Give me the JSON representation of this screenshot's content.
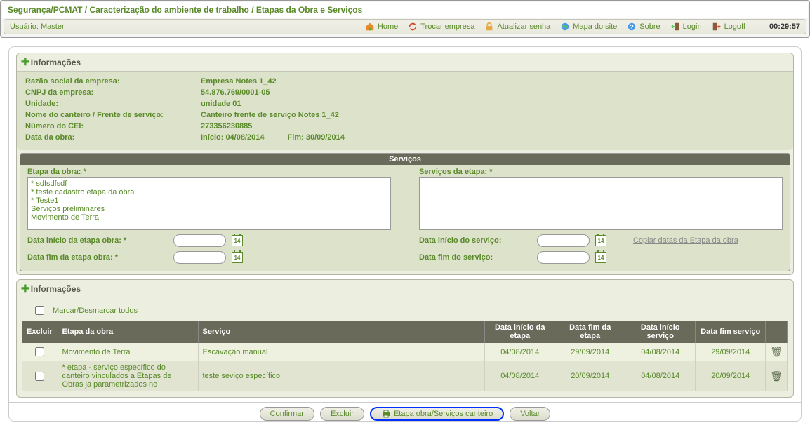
{
  "breadcrumb": "Segurança/PCMAT / Caracterização do ambiente de trabalho / Etapas da Obra e Serviços",
  "user": {
    "label": "Usuário: Master"
  },
  "nav": {
    "home": "Home",
    "trocar_empresa": "Trocar empresa",
    "atualizar_senha": "Atualizar senha",
    "mapa_site": "Mapa do site",
    "sobre": "Sobre",
    "login": "Login",
    "logoff": "Logoff"
  },
  "timer": "00:29:57",
  "panels": {
    "info_title": "Informações",
    "info2_title": "Informações"
  },
  "info": {
    "razao_social_label": "Razão social da empresa:",
    "razao_social_value": "Empresa Notes 1_42",
    "cnpj_label": "CNPJ da empresa:",
    "cnpj_value": "54.876.769/0001-05",
    "unidade_label": "Unidade:",
    "unidade_value": "unidade 01",
    "canteiro_label": "Nome do canteiro / Frente de serviço:",
    "canteiro_value": "Canteiro frente de serviço Notes 1_42",
    "cei_label": "Número do CEI:",
    "cei_value": "273356230885",
    "data_obra_label": "Data da obra:",
    "data_obra_inicio": "Início: 04/08/2014",
    "data_obra_fim": "Fim: 30/09/2014"
  },
  "servicos": {
    "section_title": "Serviços",
    "etapa_label": "Etapa da obra: *",
    "servicos_label": "Serviços da etapa: *",
    "etapa_items": [
      "* sdfsdfsdf",
      "* teste cadastro etapa da obra",
      "* Teste1",
      "Serviços preliminares",
      "Movimento de Terra"
    ],
    "data_inicio_etapa_label": "Data início da etapa obra: *",
    "data_fim_etapa_label": "Data fim da etapa obra: *",
    "data_inicio_servico_label": "Data início do serviço:",
    "data_fim_servico_label": "Data fim do serviço:",
    "copiar_datas": "Copiar datas da Etapa da obra",
    "cal_day": "14"
  },
  "grid": {
    "marcar_label": "Marcar/Desmarcar todos",
    "headers": {
      "excluir": "Excluir",
      "etapa": "Etapa da obra",
      "servico": "Serviço",
      "data_inicio_etapa": "Data início da etapa",
      "data_fim_etapa": "Data fim da etapa",
      "data_inicio_servico": "Data início serviço",
      "data_fim_servico": "Data fim serviço"
    },
    "rows": [
      {
        "etapa": "Movimento de Terra",
        "servico": "Escavação manual",
        "di_etapa": "04/08/2014",
        "df_etapa": "29/09/2014",
        "di_serv": "04/08/2014",
        "df_serv": "29/09/2014"
      },
      {
        "etapa": "* etapa - serviço específico do canteiro vinculados a Etapas de Obras ja parametrizados no",
        "servico": "teste seviço específico",
        "di_etapa": "04/08/2014",
        "df_etapa": "20/09/2014",
        "di_serv": "04/08/2014",
        "df_serv": "20/09/2014"
      }
    ]
  },
  "buttons": {
    "confirmar": "Confirmar",
    "excluir": "Excluir",
    "etapa_obra": "Etapa obra/Serviços canteiro",
    "voltar": "Voltar"
  }
}
